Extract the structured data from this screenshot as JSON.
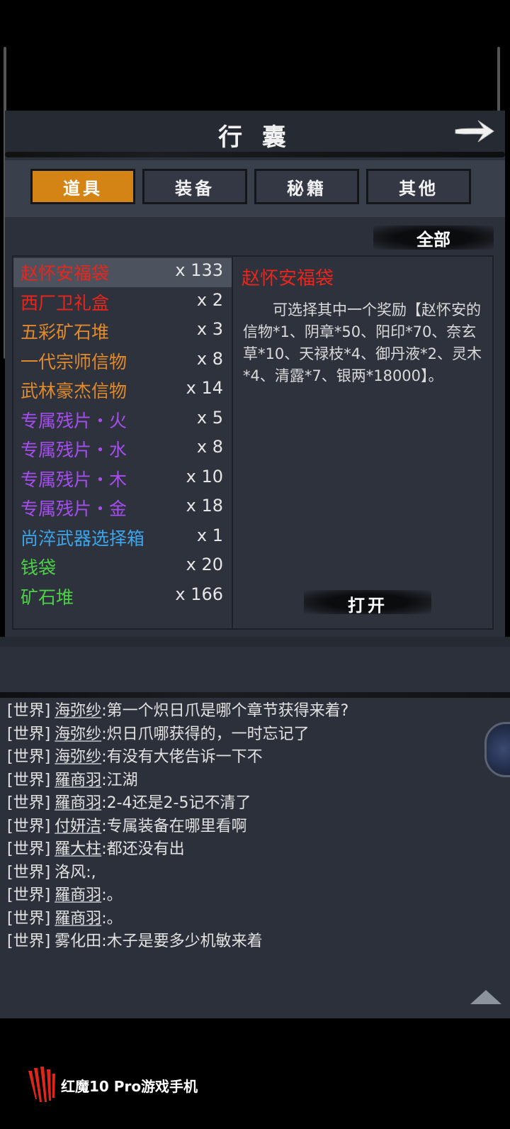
{
  "bag": {
    "title": "行 囊",
    "tabs": [
      {
        "label": "道具",
        "active": true
      },
      {
        "label": "装备",
        "active": false
      },
      {
        "label": "秘籍",
        "active": false
      },
      {
        "label": "其他",
        "active": false
      }
    ],
    "filter_label": "全部",
    "items": [
      {
        "name": "赵怀安福袋",
        "qty": "x 133",
        "color": "#e8261c",
        "selected": true
      },
      {
        "name": "西厂卫礼盒",
        "qty": "x 2",
        "color": "#e8261c"
      },
      {
        "name": "五彩矿石堆",
        "qty": "x 3",
        "color": "#e08a2c"
      },
      {
        "name": "一代宗师信物",
        "qty": "x 8",
        "color": "#e08a2c"
      },
      {
        "name": "武林豪杰信物",
        "qty": "x 14",
        "color": "#e08a2c"
      },
      {
        "name": "专属残片・火",
        "qty": "x 5",
        "color": "#a64df0"
      },
      {
        "name": "专属残片・水",
        "qty": "x 8",
        "color": "#a64df0"
      },
      {
        "name": "专属残片・木",
        "qty": "x 10",
        "color": "#a64df0"
      },
      {
        "name": "专属残片・金",
        "qty": "x 18",
        "color": "#a64df0"
      },
      {
        "name": "尚淬武器选择箱",
        "qty": "x 1",
        "color": "#3ca4ea"
      },
      {
        "name": "钱袋",
        "qty": "x 20",
        "color": "#4ed048"
      },
      {
        "name": "矿石堆",
        "qty": "x 166",
        "color": "#4ed048"
      }
    ],
    "detail": {
      "title": "赵怀安福袋",
      "description": "可选择其中一个奖励【赵怀安的信物*1、阴章*50、阳印*70、奈玄草*10、天禄枝*4、御丹液*2、灵木*4、清露*7、银两*18000】。",
      "open_label": "打开"
    }
  },
  "chat": {
    "messages": [
      {
        "channel": "[世界]",
        "user": "海弥纱",
        "text": ":第一个炽日爪是哪个章节获得来着?",
        "underline": true
      },
      {
        "channel": "[世界]",
        "user": "海弥纱",
        "text": ":炽日爪哪获得的，一时忘记了",
        "underline": true
      },
      {
        "channel": "[世界]",
        "user": "海弥纱",
        "text": ":有没有大佬告诉一下不",
        "underline": true
      },
      {
        "channel": "[世界]",
        "user": "羅商羽",
        "text": ":江湖",
        "underline": true
      },
      {
        "channel": "[世界]",
        "user": "羅商羽",
        "text": ":2-4还是2-5记不清了",
        "underline": true
      },
      {
        "channel": "[世界]",
        "user": "付妍洁",
        "text": ":专属装备在哪里看啊",
        "underline": true
      },
      {
        "channel": "[世界]",
        "user": "羅大柱",
        "text": ":都还没有出",
        "underline": true
      },
      {
        "channel": "[世界]",
        "user": "洛风",
        "text": ":,",
        "underline": false
      },
      {
        "channel": "[世界]",
        "user": "羅商羽",
        "text": ":。",
        "underline": true
      },
      {
        "channel": "[世界]",
        "user": "羅商羽",
        "text": ":。",
        "underline": true
      },
      {
        "channel": "[世界]",
        "user": "雾化田",
        "text": ":木子是要多少机敏来着",
        "underline": false
      }
    ]
  },
  "watermark": {
    "text": "红魔10 Pro游戏手机"
  }
}
